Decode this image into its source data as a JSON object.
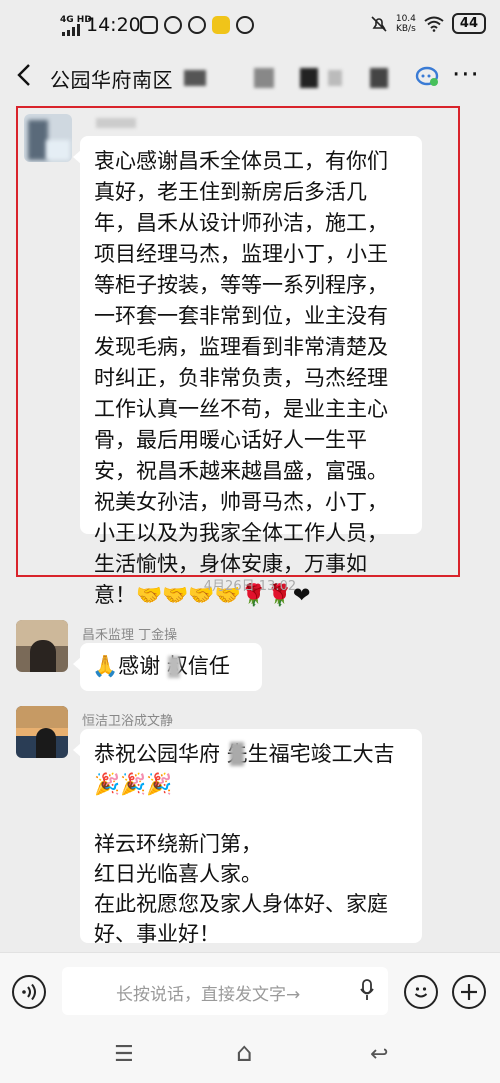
{
  "status_bar": {
    "network": "4G HD",
    "time": "14:20",
    "speed_value": "10.4",
    "speed_unit": "KB/s",
    "battery": "44"
  },
  "header": {
    "title": "公园华府南区",
    "back_icon": "chevron-left-icon",
    "more_label": "···"
  },
  "messages": [
    {
      "sender": "",
      "text": "衷心感谢昌禾全体员工，有你们真好，老王住到新房后多活几年，昌禾从设计师孙洁，施工，项目经理马杰，监理小丁，小王等柜子按装，等等一系列程序，一环套一套非常到位，业主没有发现毛病，监理看到非常清楚及时纠正，负非常负责，马杰经理工作认真一丝不苟，是业主主心骨，最后用暖心话好人一生平安，祝昌禾越来越昌盛，富强。祝美女孙洁，帅哥马杰，小丁，小王以及为我家全体工作人员，生活愉快，身体安康，万事如意！",
      "emoji": "🤝🤝🤝🤝🌹🌹❤"
    },
    {
      "sender": "昌禾监理  丁金操",
      "text": "感谢  叔信任",
      "emoji": "🙏"
    },
    {
      "sender": "恒洁卫浴成文静",
      "text": "恭祝公园华府  先生福宅竣工大吉",
      "emoji": "🎉🎉🎉",
      "text2": "祥云环绕新门第，\n红日光临喜人家。\n在此祝愿您及家人身体好、家庭好、事业好！",
      "emoji2": "🧧🧧🧧"
    }
  ],
  "timestamp": "4月26日 13:02",
  "input_bar": {
    "placeholder": "长按说话，直接发文字→"
  },
  "nav": {
    "menu": "☰",
    "home": "⌂",
    "back": "↩"
  }
}
